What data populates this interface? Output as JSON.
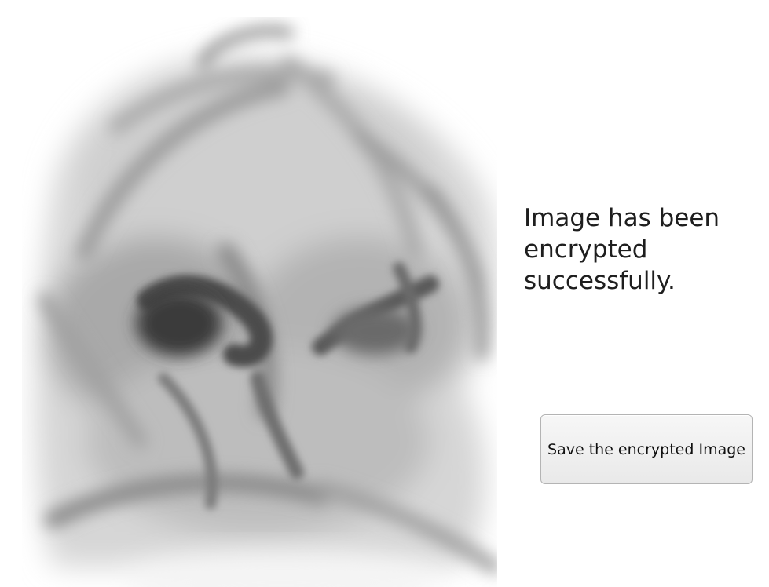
{
  "status": {
    "message": "Image has been\nencrypted\nsuccessfully."
  },
  "actions": {
    "save_label": "Save the encrypted Image"
  }
}
